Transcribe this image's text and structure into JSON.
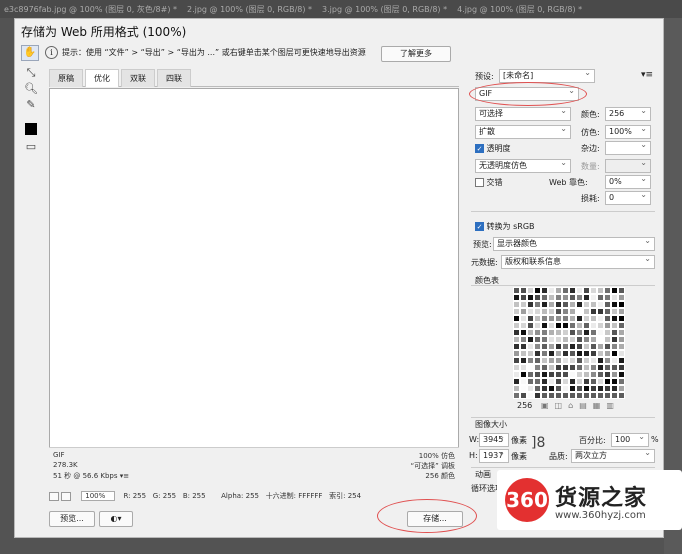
{
  "ps_tabs": [
    "e3c8976fab.jpg @ 100% (图层 0, 灰色/8#) *",
    "2.jpg @ 100% (图层 0, RGB/8) *",
    "3.jpg @ 100% (图层 0, RGB/8) *",
    "4.jpg @ 100% (图层 0, RGB/8) *"
  ],
  "dialog": {
    "title": "存储为 Web 所用格式 (100%)",
    "hint": "提示：使用 “文件” > “导出” > “导出为 ...” 或右键单击某个图层可更快速地导出资源",
    "learn_more": "了解更多",
    "tabs": [
      "原稿",
      "优化",
      "双联",
      "四联"
    ]
  },
  "preview_footer": {
    "format": "GIF",
    "size": "278.3K",
    "time": "51 秒 @ 56.6 Kbps",
    "dither": "100% 仿色",
    "palette": "“可选择” 调板",
    "colors": "256 颜色"
  },
  "statusbar": {
    "zoom": "100%",
    "r": "R: 255",
    "g": "G: 255",
    "b": "B: 255",
    "alpha": "Alpha: 255",
    "hex": "十六进制: FFFFFF",
    "index": "索引: 254"
  },
  "buttons": {
    "preview": "预览...",
    "save": "存储..."
  },
  "panel": {
    "preset_label": "预设:",
    "preset_value": "[未命名]",
    "format": "GIF",
    "reduction": "可选择",
    "colors_label": "颜色:",
    "colors_value": "256",
    "dither_method": "扩散",
    "dither_label": "仿色:",
    "dither_value": "100%",
    "transparency_label": "透明度",
    "matte_label": "杂边:",
    "transp_dither": "无透明度仿色",
    "amount_label": "数量:",
    "interlaced_label": "交错",
    "web_snap_label": "Web 靠色:",
    "web_snap_value": "0%",
    "lossy_label": "损耗:",
    "lossy_value": "0",
    "convert_srgb_label": "转换为 sRGB",
    "preview_label": "预览:",
    "preview_value": "显示器颜色",
    "metadata_label": "元数据:",
    "metadata_value": "版权和联系信息",
    "color_table_label": "颜色表",
    "color_count": "256",
    "image_size_label": "图像大小",
    "w_label": "W:",
    "w_value": "3945",
    "h_label": "H:",
    "h_value": "1937",
    "px_unit": "像素",
    "percent_label": "百分比:",
    "percent_value": "100",
    "percent_unit": "%",
    "quality_label": "品质:",
    "quality_value": "两次立方",
    "animation_label": "动画",
    "loop_label": "循环选项"
  },
  "logo": {
    "circle": "360",
    "main": "货源之家",
    "url": "www.360hyzj.com"
  },
  "colors": {
    "accent_red": "#e33030",
    "annotation_red": "#e05050"
  }
}
